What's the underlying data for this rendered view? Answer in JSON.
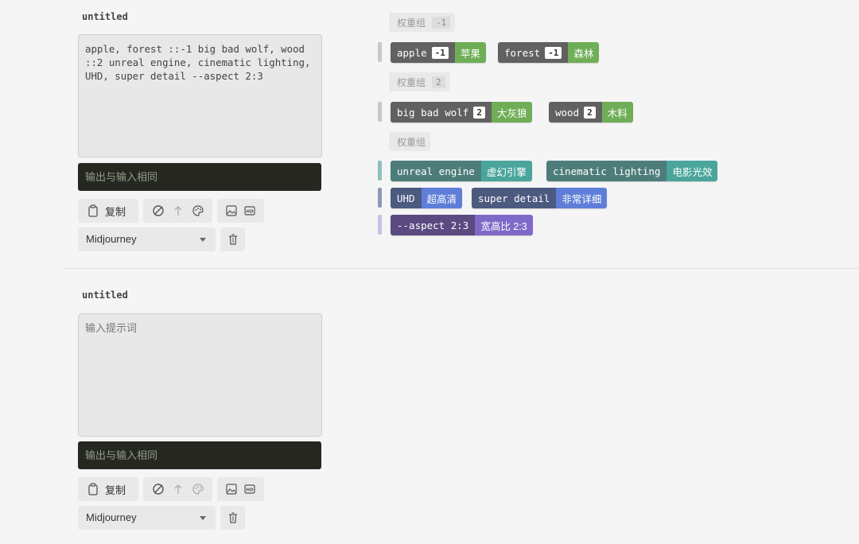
{
  "colors": {
    "gray_en": "#616161",
    "green_zh": "#6fae56",
    "teal_en": "#4d7d7a",
    "teal_zh": "#4aa59b",
    "blue_en": "#4c5a80",
    "blue_zh": "#5e7ed8",
    "purple_en": "#5a4a80",
    "purple_zh": "#7f69c8",
    "bar_gray": "#c8c8c8",
    "bar_teal": "#8ec1bc",
    "bar_blue": "#8d98b7",
    "bar_purple": "#c8c2e0"
  },
  "panels": [
    {
      "title": "untitled",
      "input_text": "apple, forest ::-1 big bad wolf, wood ::2 unreal engine, cinematic lighting, UHD, super detail --aspect 2:3",
      "input_placeholder": "",
      "output_placeholder": "输出与输入相同",
      "copy_label": "复制",
      "model_select": "Midjourney",
      "icons": [
        "clipboard-icon",
        "clear-icon",
        "arrow-up-icon",
        "palette-icon",
        "image-icon",
        "hd-icon",
        "trash-icon",
        "chevron-down-icon"
      ]
    },
    {
      "title": "untitled",
      "input_text": "",
      "input_placeholder": "输入提示词",
      "output_placeholder": "输出与输入相同",
      "copy_label": "复制",
      "model_select": "Midjourney"
    }
  ],
  "weight_groups": [
    {
      "label": "权重组",
      "weight": "-1",
      "tags": [
        {
          "en": "apple",
          "weight": "-1",
          "zh": "苹果"
        },
        {
          "en": "forest",
          "weight": "-1",
          "zh": "森林"
        }
      ]
    },
    {
      "label": "权重组",
      "weight": "2",
      "tags": [
        {
          "en": "big bad wolf",
          "weight": "2",
          "zh": "大灰狼"
        },
        {
          "en": "wood",
          "weight": "2",
          "zh": "木料"
        }
      ]
    },
    {
      "label": "权重组",
      "weight": "",
      "rows": [
        [
          {
            "en": "unreal engine",
            "zh": "虚幻引擎"
          },
          {
            "en": "cinematic lighting",
            "zh": "电影光效"
          }
        ],
        [
          {
            "en": "UHD",
            "zh": "超高清"
          },
          {
            "en": "super detail",
            "zh": "非常详细"
          }
        ],
        [
          {
            "en": "--aspect 2:3",
            "zh": "宽高比 2:3"
          }
        ]
      ]
    }
  ]
}
